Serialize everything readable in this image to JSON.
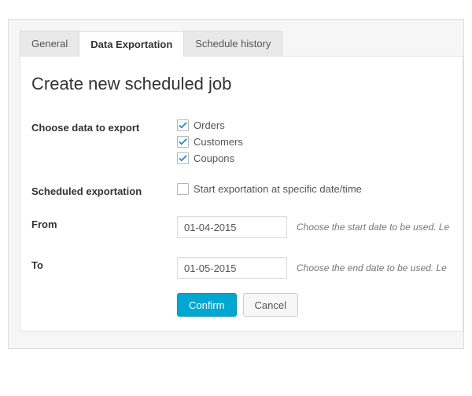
{
  "tabs": {
    "general": "General",
    "data_exportation": "Data Exportation",
    "schedule_history": "Schedule history"
  },
  "heading": "Create new scheduled job",
  "form": {
    "choose_label": "Choose data to export",
    "options": {
      "orders": "Orders",
      "customers": "Customers",
      "coupons": "Coupons"
    },
    "scheduled_label": "Scheduled exportation",
    "scheduled_option": "Start exportation at specific date/time",
    "from_label": "From",
    "from_value": "01-04-2015",
    "from_hint": "Choose the start date to be used. Le",
    "to_label": "To",
    "to_value": "01-05-2015",
    "to_hint": "Choose the end date to be used. Le",
    "confirm": "Confirm",
    "cancel": "Cancel"
  }
}
